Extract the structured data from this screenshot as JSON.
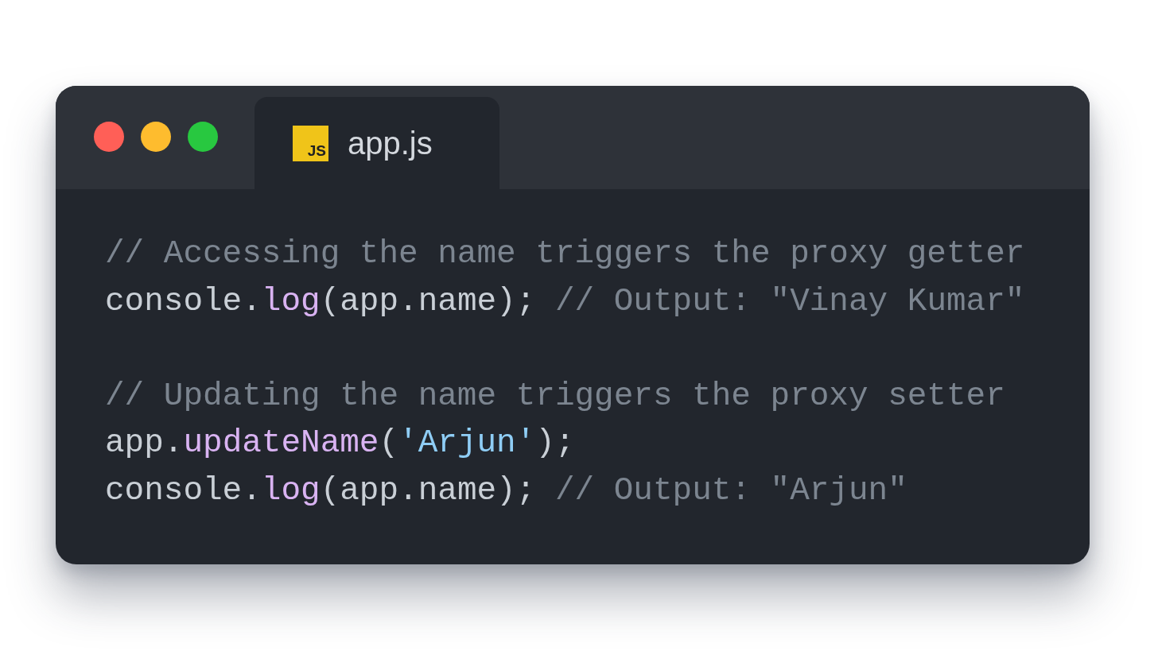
{
  "window": {
    "controls": [
      {
        "color": "#ff5f57"
      },
      {
        "color": "#febc2e"
      },
      {
        "color": "#28c840"
      }
    ]
  },
  "tabs": [
    {
      "icon_label": "JS",
      "label": "app.js",
      "selected": true
    }
  ],
  "code_blocks": [
    [
      {
        "tokens": [
          {
            "kind": "comment",
            "text": "// Accessing the name triggers the proxy getter"
          }
        ]
      },
      {
        "tokens": [
          {
            "kind": "plain",
            "text": "console."
          },
          {
            "kind": "function",
            "text": "log"
          },
          {
            "kind": "plain",
            "text": "(app.name); "
          },
          {
            "kind": "comment",
            "text": "// Output: \"Vinay Kumar\""
          }
        ]
      }
    ],
    [
      {
        "tokens": [
          {
            "kind": "comment",
            "text": "// Updating the name triggers the proxy setter"
          }
        ]
      },
      {
        "tokens": [
          {
            "kind": "plain",
            "text": "app."
          },
          {
            "kind": "function",
            "text": "updateName"
          },
          {
            "kind": "plain",
            "text": "("
          },
          {
            "kind": "string",
            "text": "'Arjun'"
          },
          {
            "kind": "plain",
            "text": ");"
          }
        ]
      },
      {
        "tokens": [
          {
            "kind": "plain",
            "text": "console."
          },
          {
            "kind": "function",
            "text": "log"
          },
          {
            "kind": "plain",
            "text": "(app.name); "
          },
          {
            "kind": "comment",
            "text": "// Output: \"Arjun\""
          }
        ]
      }
    ]
  ]
}
